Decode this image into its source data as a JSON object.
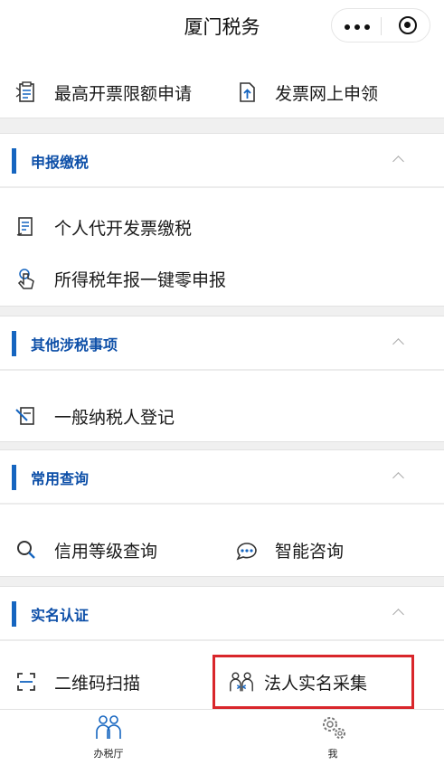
{
  "header": {
    "title": "厦门税务"
  },
  "top_items": [
    {
      "label": "最高开票限额申请",
      "icon": "invoice-limit-icon"
    },
    {
      "label": "发票网上申领",
      "icon": "invoice-upload-icon"
    }
  ],
  "sections": [
    {
      "title": "申报缴税",
      "items": [
        {
          "label": "个人代开发票缴税"
        },
        {
          "label": "所得税年报一键零申报"
        }
      ]
    },
    {
      "title": "其他涉税事项",
      "items": [
        {
          "label": "一般纳税人登记"
        }
      ]
    },
    {
      "title": "常用查询",
      "items": [
        {
          "label": "信用等级查询"
        },
        {
          "label": "智能咨询"
        }
      ]
    },
    {
      "title": "实名认证",
      "items": [
        {
          "label": "二维码扫描"
        },
        {
          "label": "法人实名采集"
        }
      ]
    }
  ],
  "tabbar": [
    {
      "label": "办税厅",
      "icon": "people-icon"
    },
    {
      "label": "我",
      "icon": "gears-icon"
    }
  ],
  "colors": {
    "accent": "#1565c0",
    "section_title": "#0d4fa8",
    "highlight": "#d9262b",
    "divider": "#f0f0f0"
  }
}
